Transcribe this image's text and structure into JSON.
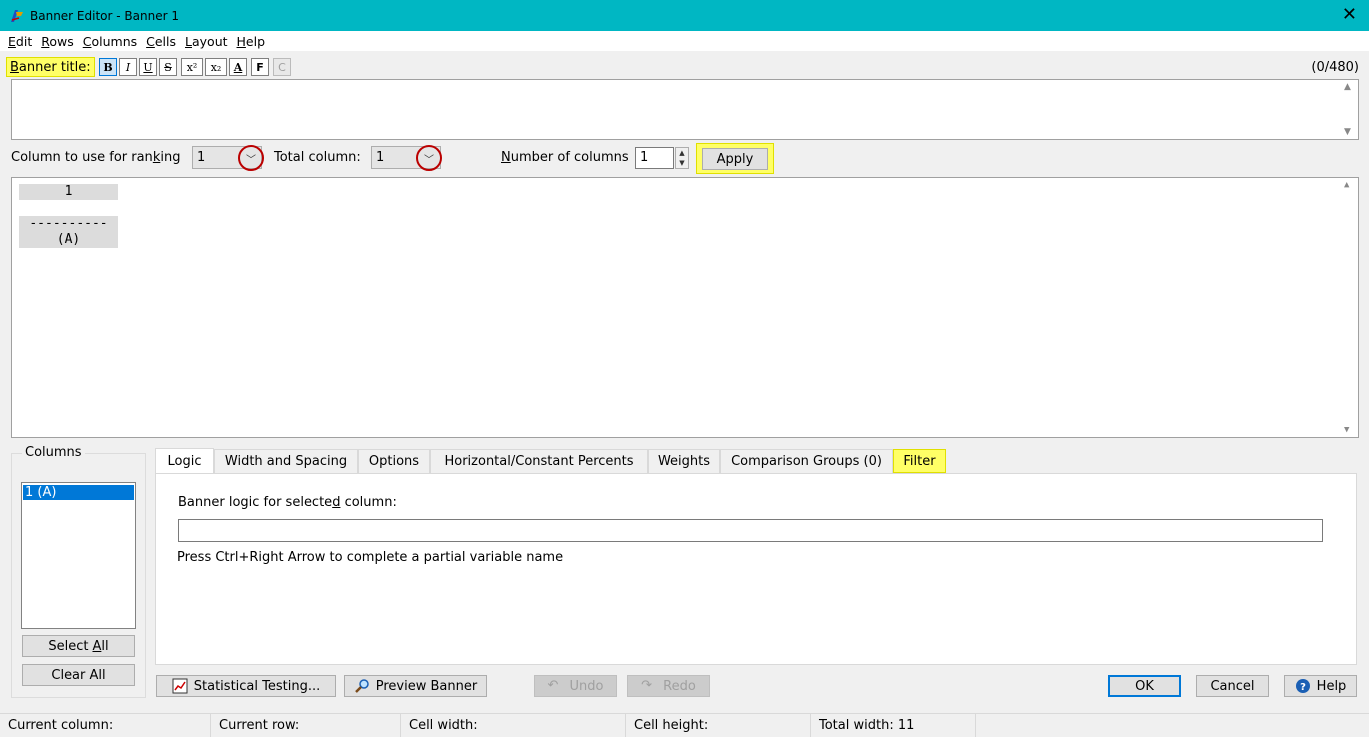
{
  "window": {
    "title": "Banner Editor - Banner 1",
    "close_glyph": "✕"
  },
  "menu": [
    "Edit",
    "Rows",
    "Columns",
    "Cells",
    "Layout",
    "Help"
  ],
  "menu_underline": [
    "E",
    "R",
    "C",
    "C",
    "L",
    "H"
  ],
  "title_toolbar": {
    "label": "Banner title:",
    "buttons": [
      "B",
      "I",
      "U",
      "S",
      "x²",
      "x₂",
      "A",
      "F",
      "C"
    ],
    "counter": "(0/480)"
  },
  "settings": {
    "ranking_label": "Column to use for ranking",
    "ranking_value": "1",
    "total_label": "Total column:",
    "total_value": "1",
    "num_columns_label": "Number of columns",
    "num_columns_value": "1",
    "apply_label": "Apply"
  },
  "preview": {
    "header": "1",
    "rule": "----------",
    "letter": "(A)"
  },
  "columns_panel": {
    "legend": "Columns",
    "items": [
      "1 (A)"
    ],
    "select_all": "Select All",
    "clear_all": "Clear All"
  },
  "tabs": [
    "Logic",
    "Width and Spacing",
    "Options",
    "Horizontal/Constant Percents",
    "Weights",
    "Comparison Groups (0)",
    "Filter"
  ],
  "logic_tab": {
    "prompt": "Banner logic for selected column:",
    "input_value": "",
    "hint": "Press Ctrl+Right Arrow to complete a partial variable name"
  },
  "bottom_buttons": {
    "stat_testing": "Statistical Testing...",
    "preview_banner": "Preview Banner",
    "undo": "Undo",
    "redo": "Redo",
    "ok": "OK",
    "cancel": "Cancel",
    "help": "Help"
  },
  "status": {
    "current_column": "Current column:",
    "current_row": "Current row:",
    "cell_width": "Cell width:",
    "cell_height": "Cell height:",
    "total_width": "Total width: 11"
  },
  "colors": {
    "titlebar": "#00b7c3",
    "highlight": "#ffff66",
    "selection": "#0078d7",
    "callout_circle": "#bb0000"
  }
}
